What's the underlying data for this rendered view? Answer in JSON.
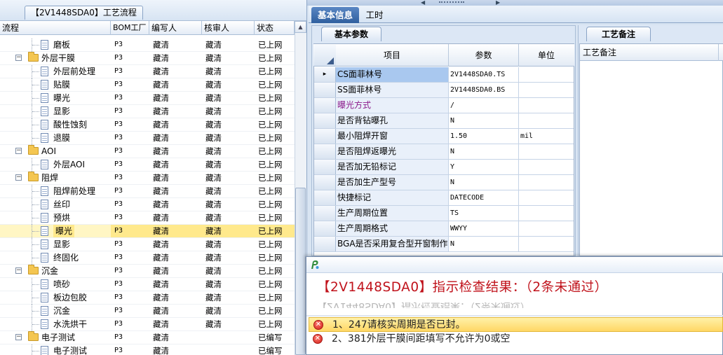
{
  "left_panel": {
    "tab_title": "【2V1448SDA0】工艺流程",
    "columns": [
      "流程",
      "BOM工厂",
      "编写人",
      "核审人",
      "状态"
    ],
    "rows": [
      {
        "name": "磨板",
        "kind": "doc",
        "level": 2,
        "bom": "P3",
        "writer": "藏清",
        "reviewer": "藏清",
        "status": "已上网"
      },
      {
        "name": "外层干膜",
        "kind": "folder",
        "level": 1,
        "bom": "P3",
        "writer": "藏清",
        "reviewer": "藏清",
        "status": "已上网"
      },
      {
        "name": "外层前处理",
        "kind": "doc",
        "level": 2,
        "bom": "P3",
        "writer": "藏清",
        "reviewer": "藏清",
        "status": "已上网"
      },
      {
        "name": "贴膜",
        "kind": "doc",
        "level": 2,
        "bom": "P3",
        "writer": "藏清",
        "reviewer": "藏清",
        "status": "已上网"
      },
      {
        "name": "曝光",
        "kind": "doc",
        "level": 2,
        "bom": "P3",
        "writer": "藏清",
        "reviewer": "藏清",
        "status": "已上网"
      },
      {
        "name": "显影",
        "kind": "doc",
        "level": 2,
        "bom": "P3",
        "writer": "藏清",
        "reviewer": "藏清",
        "status": "已上网"
      },
      {
        "name": "酸性蚀刻",
        "kind": "doc",
        "level": 2,
        "bom": "P3",
        "writer": "藏清",
        "reviewer": "藏清",
        "status": "已上网"
      },
      {
        "name": "退膜",
        "kind": "doc",
        "level": 2,
        "bom": "P3",
        "writer": "藏清",
        "reviewer": "藏清",
        "status": "已上网"
      },
      {
        "name": "AOI",
        "kind": "folder",
        "level": 1,
        "bom": "P3",
        "writer": "藏清",
        "reviewer": "藏清",
        "status": "已上网"
      },
      {
        "name": "外层AOI",
        "kind": "doc",
        "level": 2,
        "bom": "P3",
        "writer": "藏清",
        "reviewer": "藏清",
        "status": "已上网"
      },
      {
        "name": "阻焊",
        "kind": "folder",
        "level": 1,
        "bom": "P3",
        "writer": "藏清",
        "reviewer": "藏清",
        "status": "已上网"
      },
      {
        "name": "阻焊前处理",
        "kind": "doc",
        "level": 2,
        "bom": "P3",
        "writer": "藏清",
        "reviewer": "藏清",
        "status": "已上网"
      },
      {
        "name": "丝印",
        "kind": "doc",
        "level": 2,
        "bom": "P3",
        "writer": "藏清",
        "reviewer": "藏清",
        "status": "已上网"
      },
      {
        "name": "预烘",
        "kind": "doc",
        "level": 2,
        "bom": "P3",
        "writer": "藏清",
        "reviewer": "藏清",
        "status": "已上网"
      },
      {
        "name": "曝光",
        "kind": "doc",
        "level": 2,
        "bom": "P3",
        "writer": "藏清",
        "reviewer": "藏清",
        "status": "已上网",
        "selected": true
      },
      {
        "name": "显影",
        "kind": "doc",
        "level": 2,
        "bom": "P3",
        "writer": "藏清",
        "reviewer": "藏清",
        "status": "已上网"
      },
      {
        "name": "终固化",
        "kind": "doc",
        "level": 2,
        "bom": "P3",
        "writer": "藏清",
        "reviewer": "藏清",
        "status": "已上网"
      },
      {
        "name": "沉金",
        "kind": "folder",
        "level": 1,
        "bom": "P3",
        "writer": "藏清",
        "reviewer": "藏清",
        "status": "已上网"
      },
      {
        "name": "喷砂",
        "kind": "doc",
        "level": 2,
        "bom": "P3",
        "writer": "藏清",
        "reviewer": "藏清",
        "status": "已上网"
      },
      {
        "name": "板边包胶",
        "kind": "doc",
        "level": 2,
        "bom": "P3",
        "writer": "藏清",
        "reviewer": "藏清",
        "status": "已上网"
      },
      {
        "name": "沉金",
        "kind": "doc",
        "level": 2,
        "bom": "P3",
        "writer": "藏清",
        "reviewer": "藏清",
        "status": "已上网"
      },
      {
        "name": "水洗烘干",
        "kind": "doc",
        "level": 2,
        "bom": "P3",
        "writer": "藏清",
        "reviewer": "藏清",
        "status": "已上网"
      },
      {
        "name": "电子测试",
        "kind": "folder",
        "level": 1,
        "bom": "P3",
        "writer": "藏清",
        "reviewer": "",
        "status": "已编写"
      },
      {
        "name": "电子测试",
        "kind": "doc",
        "level": 2,
        "bom": "P3",
        "writer": "藏清",
        "reviewer": "",
        "status": "已编写"
      }
    ]
  },
  "right_tabs": {
    "basic": "基本信息",
    "hours": "工时"
  },
  "param_panel": {
    "tab": "基本参数",
    "headers": {
      "item": "项目",
      "param": "参数",
      "unit": "单位"
    },
    "current_marker": "▸",
    "rows": [
      {
        "item": "CS面菲林号",
        "param": "2V1448SDA0.TS",
        "unit": "",
        "current": true
      },
      {
        "item": "SS面菲林号",
        "param": "2V1448SDA0.BS",
        "unit": ""
      },
      {
        "item": "曝光方式",
        "param": "/",
        "unit": "",
        "purple": true
      },
      {
        "item": "是否背钻曝孔",
        "param": "N",
        "unit": ""
      },
      {
        "item": "最小阻焊开窗",
        "param": "1.50",
        "unit": "mil"
      },
      {
        "item": "是否阻焊返曝光",
        "param": "N",
        "unit": ""
      },
      {
        "item": "是否加无铅标记",
        "param": "Y",
        "unit": ""
      },
      {
        "item": "是否加生产型号",
        "param": "N",
        "unit": ""
      },
      {
        "item": "快捷标记",
        "param": "DATECODE",
        "unit": ""
      },
      {
        "item": "生产周期位置",
        "param": "TS",
        "unit": ""
      },
      {
        "item": "生产周期格式",
        "param": "WWYY",
        "unit": ""
      },
      {
        "item": "BGA是否采用复合型开窗制作",
        "param": "N",
        "unit": ""
      }
    ]
  },
  "note_panel": {
    "tab": "工艺备注",
    "column": "工艺备注"
  },
  "dialog": {
    "heading": "【2V1448SDA0】指示检查结果：（2条未通过）",
    "issues": [
      {
        "text": "1、247请核实周期是否已封。",
        "highlight": true
      },
      {
        "text": "2、381外层干膜间距填写不允许为0或空",
        "highlight": false
      }
    ]
  },
  "colors": {
    "accent": "#2f5f9f",
    "selection": "#ffe98c",
    "error": "#c0121b",
    "purple_text": "#8b1a8b"
  }
}
